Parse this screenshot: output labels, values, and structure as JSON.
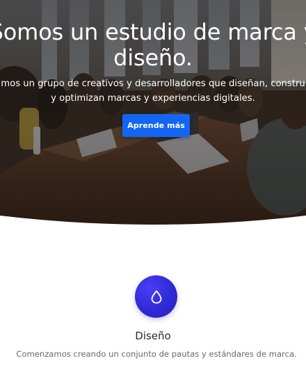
{
  "hero": {
    "title": "Somos un estudio de marca y diseño.",
    "subtitle_line1": "mos un grupo de creativos y desarrolladores que diseñan, constru",
    "subtitle_line2": "y optimizan marcas y experiencias digitales.",
    "button_label": "Aprende más"
  },
  "feature": {
    "icon": "droplet-icon",
    "title": "Diseño",
    "description": "Comenzamos creando un conjunto de pautas y estándares de marca."
  },
  "colors": {
    "accent": "#1366f2",
    "icon_circle": "#2f2ad6",
    "heading": "#2b2b2b",
    "body_text": "#6a6a6a"
  }
}
